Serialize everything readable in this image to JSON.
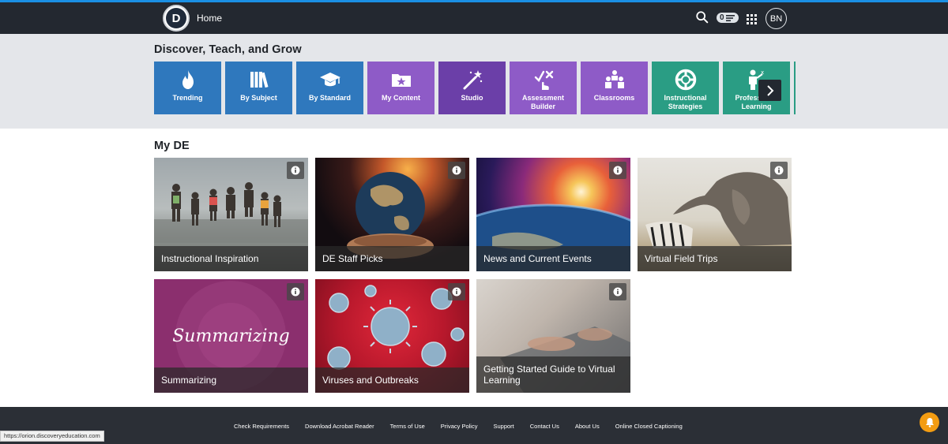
{
  "header": {
    "logo_text": "D",
    "home_label": "Home",
    "notification_count": "0",
    "avatar_initials": "BN",
    "icons": {
      "search": "search-icon",
      "notifications": "menu-lines-icon",
      "apps": "grid-icon"
    },
    "colors": {
      "bar": "#232830",
      "accent_line": "#1a8fe3"
    }
  },
  "discover": {
    "title": "Discover, Teach, and Grow",
    "tiles": [
      {
        "label": "Trending",
        "icon": "flame-icon",
        "color": "#2f78bd"
      },
      {
        "label": "By Subject",
        "icon": "books-icon",
        "color": "#2f78bd"
      },
      {
        "label": "By Standard",
        "icon": "graduation-cap-icon",
        "color": "#2f78bd"
      },
      {
        "label": "My Content",
        "icon": "star-folder-icon",
        "color": "#8e5bc7"
      },
      {
        "label": "Studio",
        "icon": "magic-wand-icon",
        "color": "#6b3fa8"
      },
      {
        "label": "Assessment Builder",
        "icon": "check-cross-icon",
        "color": "#8e5bc7"
      },
      {
        "label": "Classrooms",
        "icon": "people-group-icon",
        "color": "#8e5bc7"
      },
      {
        "label": "Instructional Strategies",
        "icon": "lifebuoy-icon",
        "color": "#2a9d84"
      },
      {
        "label": "Professional Learning",
        "icon": "teacher-board-icon",
        "color": "#2a9d84"
      }
    ],
    "next_icon": "chevron-right-icon"
  },
  "my_de": {
    "title": "My DE",
    "cards": [
      {
        "label": "Instructional Inspiration",
        "image": "kids-jumping-beach-photo"
      },
      {
        "label": "DE Staff Picks",
        "image": "hands-holding-earth-photo"
      },
      {
        "label": "News and Current Events",
        "image": "earth-sunrise-space-photo"
      },
      {
        "label": "Virtual Field Trips",
        "image": "elephant-zebra-photo"
      },
      {
        "label": "Summarizing",
        "image": "summarizing-purple-graphic",
        "art_text": "Summarizing"
      },
      {
        "label": "Viruses and Outbreaks",
        "image": "virus-particles-photo"
      },
      {
        "label": "Getting Started Guide to Virtual Learning",
        "image": "laptop-hands-photo"
      }
    ],
    "info_icon": "info-icon"
  },
  "footer": {
    "links": [
      "Check Requirements",
      "Download Acrobat Reader",
      "Terms of Use",
      "Privacy Policy",
      "Support",
      "Contact Us",
      "About Us",
      "Online Closed Captioning"
    ]
  },
  "status_bar": {
    "url": "https://orion.discoveryeducation.com"
  },
  "bell_icon": "bell-icon"
}
